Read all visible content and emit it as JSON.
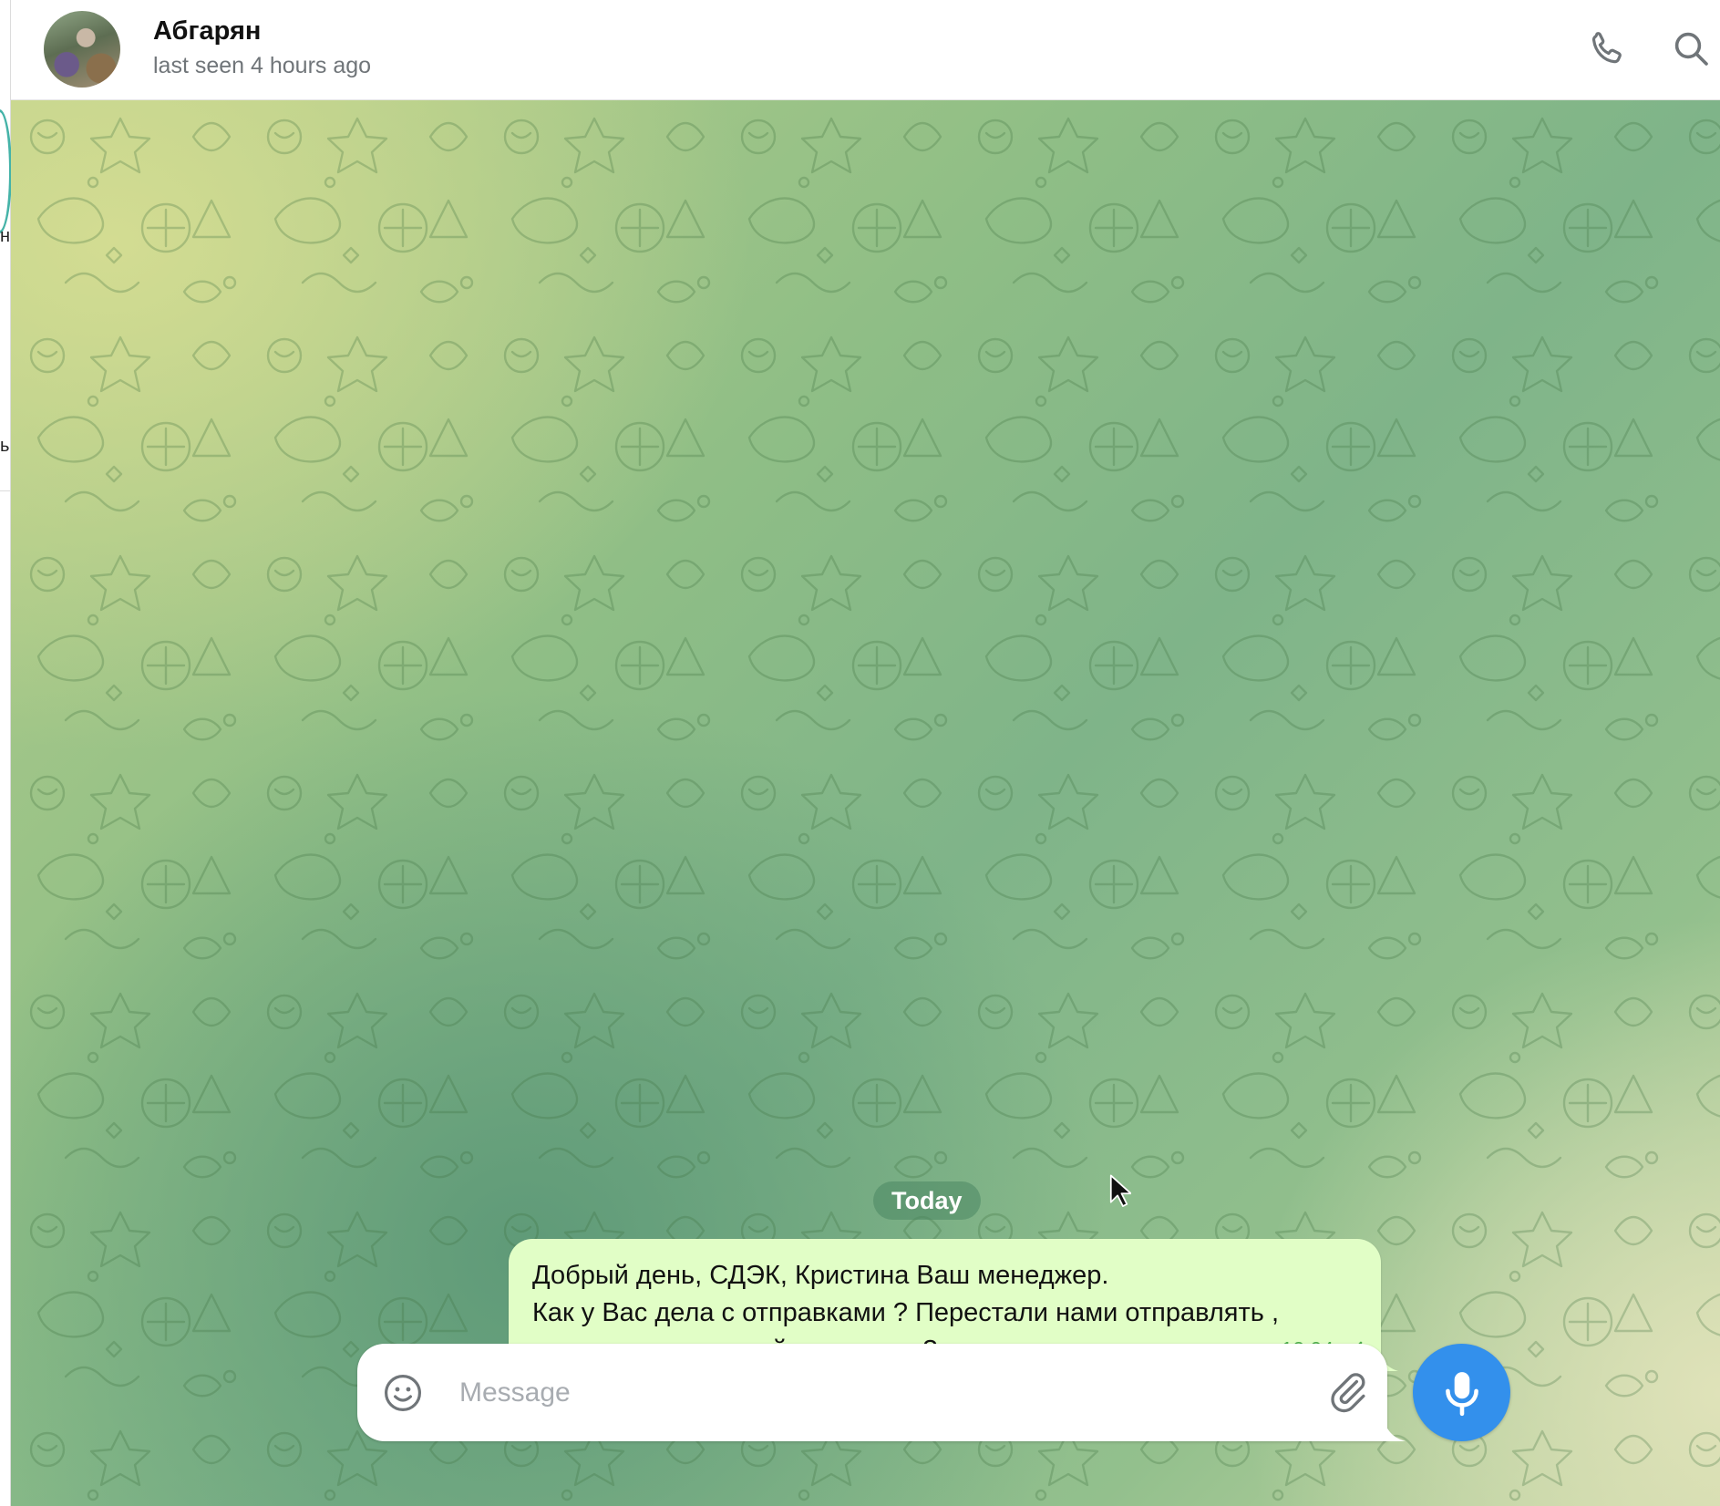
{
  "header": {
    "contact_name": "Абгарян",
    "status": "last seen 4 hours ago",
    "avatar_icon": "contact-avatar-photo",
    "call_icon": "phone-icon",
    "search_icon": "search-icon"
  },
  "sidebar_fragment": {
    "glyph_1": "н",
    "glyph_2": "ь"
  },
  "chat": {
    "date_label": "Today",
    "messages": [
      {
        "lines": [
          "Добрый день, СДЭК, Кристина Ваш менеджер.",
          "Как у Вас дела с отправками ? Перестали нами отправлять ,",
          "подскажите пожалуйста почему?"
        ],
        "time": "12:04",
        "status_icon": "check-icon"
      }
    ]
  },
  "composer": {
    "placeholder": "Message",
    "value": "",
    "emoji_icon": "smile-icon",
    "attach_icon": "paperclip-icon",
    "send_icon": "microphone-icon"
  },
  "colors": {
    "accent": "#3390ec",
    "outgoing_bubble": "#e1fec6",
    "time_text": "#4fae4e",
    "status_text": "#707579"
  }
}
